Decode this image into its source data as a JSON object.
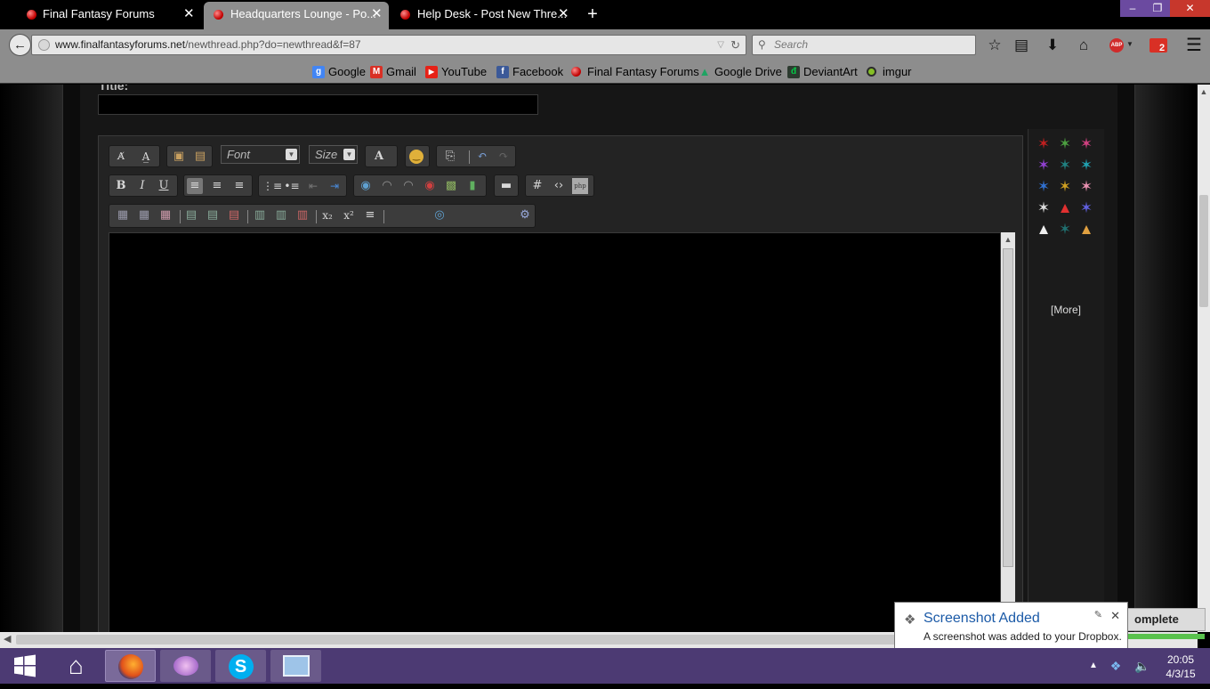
{
  "browser": {
    "tabs": [
      {
        "label": "Final Fantasy Forums",
        "active": false
      },
      {
        "label": "Headquarters Lounge - Po...",
        "active": true
      },
      {
        "label": "Help Desk - Post New Thre...",
        "active": false
      }
    ],
    "new_tab_label": "+",
    "url_domain": "www.finalfantasyforums.net",
    "url_path": "/newthread.php?do=newthread&f=87",
    "search_placeholder": "Search",
    "mail_badge": "2",
    "abp_badge": "ABP",
    "bookmarks": [
      {
        "label": "Google",
        "icon": "google-icon",
        "color": "#4285f4",
        "glyph": "g"
      },
      {
        "label": "Gmail",
        "icon": "gmail-icon",
        "color": "#d93025",
        "glyph": "M"
      },
      {
        "label": "YouTube",
        "icon": "youtube-icon",
        "color": "#e62117",
        "glyph": "▶"
      },
      {
        "label": "Facebook",
        "icon": "facebook-icon",
        "color": "#3b5998",
        "glyph": "f"
      },
      {
        "label": "Final Fantasy Forums",
        "icon": "ff-icon",
        "color": "#c00000",
        "glyph": ""
      },
      {
        "label": "Google Drive",
        "icon": "gdrive-icon",
        "color": "#1fa463",
        "glyph": "▲"
      },
      {
        "label": "DeviantArt",
        "icon": "deviantart-icon",
        "color": "#05cc47",
        "glyph": "đ"
      },
      {
        "label": "imgur",
        "icon": "imgur-icon",
        "color": "#85bf25",
        "glyph": ""
      }
    ]
  },
  "page": {
    "title_label": "Title:",
    "editor": {
      "font_select": "Font",
      "size_select": "Size"
    },
    "smilies_more": "[More]"
  },
  "notification": {
    "title": "Screenshot Added",
    "message": "A screenshot was added to your Dropbox.",
    "complete_label": "omplete"
  },
  "taskbar": {
    "time": "20:05",
    "date": "4/3/15"
  }
}
